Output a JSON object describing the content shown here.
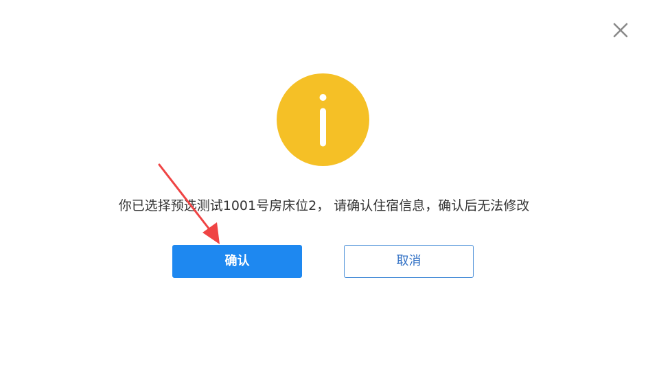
{
  "dialog": {
    "message": "你已选择预选测试1001号房床位2， 请确认住宿信息，确认后无法修改",
    "confirm_label": "确认",
    "cancel_label": "取消"
  },
  "icons": {
    "info": "info-icon",
    "close": "close-icon",
    "annotation_arrow": "arrow-icon"
  },
  "colors": {
    "info_circle": "#f5c026",
    "confirm_button": "#1e88f0",
    "cancel_border": "#4a8fd8",
    "annotation_arrow": "#ef4444"
  }
}
